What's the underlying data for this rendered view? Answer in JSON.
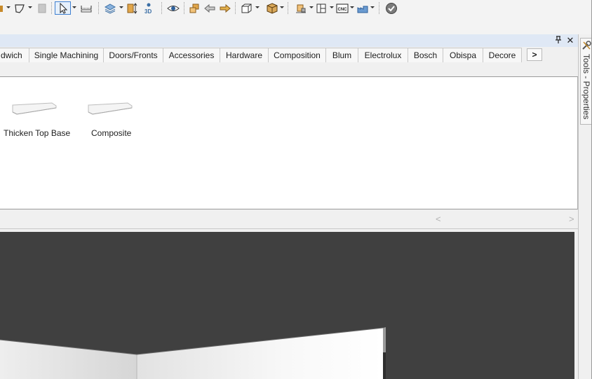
{
  "toolbar": {
    "buttons": [
      {
        "icon": "dropdown-fragment-icon"
      },
      {
        "icon": "polygon-select-icon"
      },
      {
        "icon": "grayed-block-icon"
      },
      {
        "icon": "pointer-arrow-icon",
        "active": true
      },
      {
        "icon": "measure-ruler-icon"
      },
      {
        "icon": "layers-icon"
      },
      {
        "icon": "cabinet-height-icon"
      },
      {
        "icon": "3d-view-icon",
        "text": "3D"
      },
      {
        "icon": "eye-visibility-icon"
      },
      {
        "icon": "boxes-cubes-icon"
      },
      {
        "icon": "undo-arrow-icon"
      },
      {
        "icon": "redo-arrow-icon"
      },
      {
        "icon": "frame-view-icon"
      },
      {
        "icon": "package-box-icon"
      },
      {
        "icon": "material-stack-icon"
      },
      {
        "icon": "panel-layout-icon"
      },
      {
        "icon": "cnc-icon",
        "text": "CNC"
      },
      {
        "icon": "production-factory-icon"
      },
      {
        "icon": "validate-check-icon"
      }
    ]
  },
  "panel": {
    "pin_label": "⊓",
    "close_label": "✕"
  },
  "tabs": [
    "dwich",
    "Single Machining",
    "Doors/Fronts",
    "Accessories",
    "Hardware",
    "Composition",
    "Blum",
    "Electrolux",
    "Bosch",
    "Obispa",
    "Decore"
  ],
  "tab_scroll_label": ">",
  "library": {
    "items": [
      {
        "label": "Thicken Top Base",
        "icon": "top-slab-icon"
      },
      {
        "label": "Composite",
        "icon": "top-slab-icon"
      }
    ]
  },
  "scrollbar": {
    "left_arrow": "<",
    "right_arrow": ">"
  },
  "side_dock": {
    "label": "Tools - Properties",
    "icon": "tools-wrench-icon"
  },
  "colors": {
    "viewport_bg": "#404040",
    "panel_header": "#dfe8f5",
    "active_border": "#3e7fd0"
  }
}
